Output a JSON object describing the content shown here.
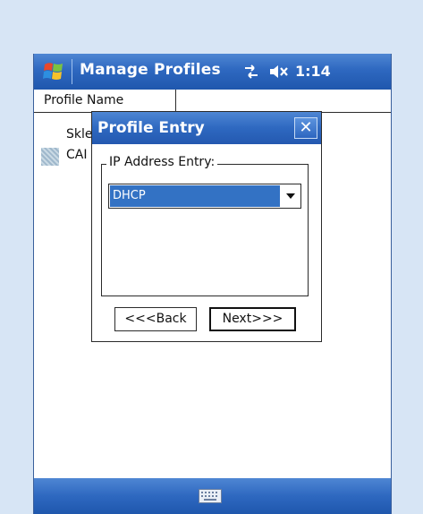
{
  "titlebar": {
    "app_title": "Manage Profiles",
    "clock": "1:14",
    "start_icon": "windows-flag-icon",
    "connectivity_icon": "connectivity-icon",
    "volume_icon": "volume-muted-icon"
  },
  "list": {
    "column_header": "Profile Name",
    "rows": [
      {
        "label": "Skle"
      },
      {
        "label": "CAI"
      }
    ]
  },
  "dialog": {
    "title": "Profile Entry",
    "close_label": "✕",
    "group_label": "IP Address Entry:",
    "select_value": "DHCP",
    "back_label": "<<<Back",
    "next_label": "Next>>>"
  },
  "bottombar": {
    "keyboard_icon": "keyboard-icon"
  },
  "colors": {
    "titlebar": "#2e68c0",
    "selection": "#3372c4",
    "background": "#d7e5f5"
  }
}
